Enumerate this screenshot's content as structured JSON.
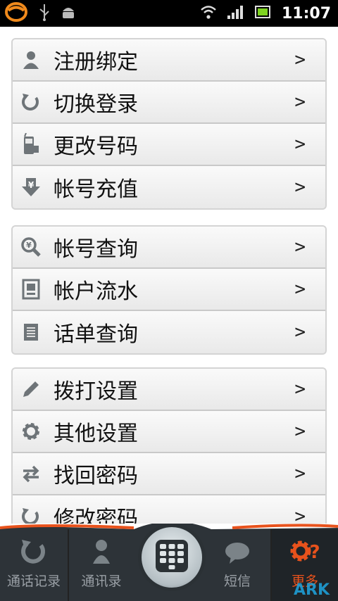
{
  "status_bar": {
    "time": "11:07"
  },
  "groups": [
    {
      "items": [
        {
          "label": "注册绑定",
          "icon": "user-icon"
        },
        {
          "label": "切换登录",
          "icon": "refresh-icon"
        },
        {
          "label": "更改号码",
          "icon": "phone-icon"
        },
        {
          "label": "帐号充值",
          "icon": "yuan-down-icon"
        }
      ]
    },
    {
      "items": [
        {
          "label": "帐号查询",
          "icon": "yuan-search-icon"
        },
        {
          "label": "帐户流水",
          "icon": "document-icon"
        },
        {
          "label": "话单查询",
          "icon": "list-icon"
        }
      ]
    },
    {
      "items": [
        {
          "label": "拨打设置",
          "icon": "pencil-icon"
        },
        {
          "label": "其他设置",
          "icon": "gear-icon"
        },
        {
          "label": "找回密码",
          "icon": "swap-icon"
        },
        {
          "label": "修改密码",
          "icon": "refresh-icon"
        }
      ]
    }
  ],
  "chevron": ">",
  "tabs": [
    {
      "label": "通话记录",
      "icon": "history-icon"
    },
    {
      "label": "通讯录",
      "icon": "contact-icon"
    },
    {
      "label": "短信",
      "icon": "chat-icon"
    },
    {
      "label": "更多",
      "icon": "gear-question-icon",
      "active": true
    }
  ],
  "watermark": "ARK",
  "colors": {
    "accent": "#e8521c",
    "tabbar": "#2d3338"
  }
}
